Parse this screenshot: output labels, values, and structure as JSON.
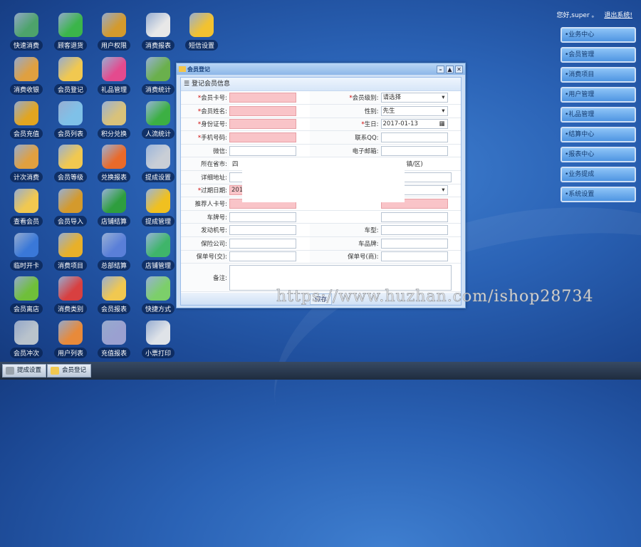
{
  "desktop_icons": [
    {
      "label": "快速消费",
      "icon": "card-icon",
      "color": "#4da36b"
    },
    {
      "label": "顾客退货",
      "icon": "user-return-icon",
      "color": "#3bb54a"
    },
    {
      "label": "用户权限",
      "icon": "user-lock-icon",
      "color": "#d49a2c"
    },
    {
      "label": "消费报表",
      "icon": "bar-report-icon",
      "color": "#e8e8e8"
    },
    {
      "label": "短信设置",
      "icon": "mail-gear-icon",
      "color": "#f2c230"
    },
    {
      "label": "消费收银",
      "icon": "cash-register-icon",
      "color": "#e0a040"
    },
    {
      "label": "会员登记",
      "icon": "user-register-icon",
      "color": "#f1c850"
    },
    {
      "label": "礼品管理",
      "icon": "gift-icon",
      "color": "#e44a8e"
    },
    {
      "label": "消费统计",
      "icon": "stats-icon",
      "color": "#6ab04c"
    },
    {
      "label": "会员充值",
      "icon": "coins-icon",
      "color": "#e2a520"
    },
    {
      "label": "会员列表",
      "icon": "user-list-icon",
      "color": "#7fc1e8"
    },
    {
      "label": "积分兑换",
      "icon": "money-bag-icon",
      "color": "#d9c27a"
    },
    {
      "label": "人流统计",
      "icon": "people-icon",
      "color": "#3cb043"
    },
    {
      "label": "计次消费",
      "icon": "count-consume-icon",
      "color": "#e0a040"
    },
    {
      "label": "会员等级",
      "icon": "user-level-icon",
      "color": "#f1c850"
    },
    {
      "label": "兑换报表",
      "icon": "pie-report-icon",
      "color": "#e96a2a"
    },
    {
      "label": "提成设置",
      "icon": "database-icon",
      "color": "#c9ced6"
    },
    {
      "label": "查看会员",
      "icon": "view-member-icon",
      "color": "#f1c850"
    },
    {
      "label": "会员导入",
      "icon": "member-import-icon",
      "color": "#d49a2c"
    },
    {
      "label": "店铺结算",
      "icon": "shop-settle-icon",
      "color": "#2e9e3e"
    },
    {
      "label": "提成管理",
      "icon": "commission-icon",
      "color": "#f0c020"
    },
    {
      "label": "临时开卡",
      "icon": "temp-card-icon",
      "color": "#3a78d8"
    },
    {
      "label": "消费项目",
      "icon": "basket-icon",
      "color": "#e8b02a"
    },
    {
      "label": "总部结算",
      "icon": "hq-settle-icon",
      "color": "#5a7fd8"
    },
    {
      "label": "店铺管理",
      "icon": "shop-manage-icon",
      "color": "#3fb56a"
    },
    {
      "label": "会员离店",
      "icon": "member-leave-icon",
      "color": "#6fbf3a"
    },
    {
      "label": "消费类别",
      "icon": "hierarchy-icon",
      "color": "#d84040"
    },
    {
      "label": "会员报表",
      "icon": "member-report-icon",
      "color": "#f1c850"
    },
    {
      "label": "快捷方式",
      "icon": "folder-icon",
      "color": "#7ccf6a"
    },
    {
      "label": "会员冲次",
      "icon": "calculator-icon",
      "color": "#b9c3cc"
    },
    {
      "label": "用户列表",
      "icon": "user-grid-icon",
      "color": "#e88a3a"
    },
    {
      "label": "充值报表",
      "icon": "recharge-report-icon",
      "color": "#9aa0d0"
    },
    {
      "label": "小票打印",
      "icon": "printer-icon",
      "color": "#dfe3e8"
    }
  ],
  "topbar": {
    "greeting": "您好,super 。",
    "logout": "退出系统!"
  },
  "right_menu": [
    "•业务中心",
    "•会员管理",
    "•消费项目",
    "•用户管理",
    "•礼品管理",
    "•结算中心",
    "•报表中心",
    "•业务提成",
    "•系统设置"
  ],
  "dialog": {
    "title": "会员登记",
    "section": "登记会员信息",
    "fields": {
      "card_no": "会员卡号:",
      "level": "会员级别:",
      "level_value": "请选择",
      "name": "会员姓名:",
      "gender": "性别:",
      "gender_value": "先生",
      "id_no": "身份证号:",
      "birthday": "生日:",
      "birthday_value": "2017-01-13",
      "mobile": "手机号码:",
      "contact": "联系QQ:",
      "wechat": "微信:",
      "email": "电子邮箱:",
      "province": "所在省市:",
      "province_value": "四",
      "region_suffix": "镇/区)",
      "address": "详细地址:",
      "expiry": "过期日期:",
      "expiry_value": "201",
      "referrer": "推荐人卡号:",
      "plate": "车牌号:",
      "engine": "发动机号:",
      "car_model": "车型:",
      "insurer": "保险公司:",
      "car_brand": "车品牌:",
      "policy_jiao": "保单号(交):",
      "policy_shang": "保单号(商):",
      "remark": "备注:"
    },
    "save": "保存"
  },
  "watermark": "https://www.huzhan.com/ishop28734",
  "taskbar": [
    {
      "label": "提成设置"
    },
    {
      "label": "会员登记"
    }
  ]
}
